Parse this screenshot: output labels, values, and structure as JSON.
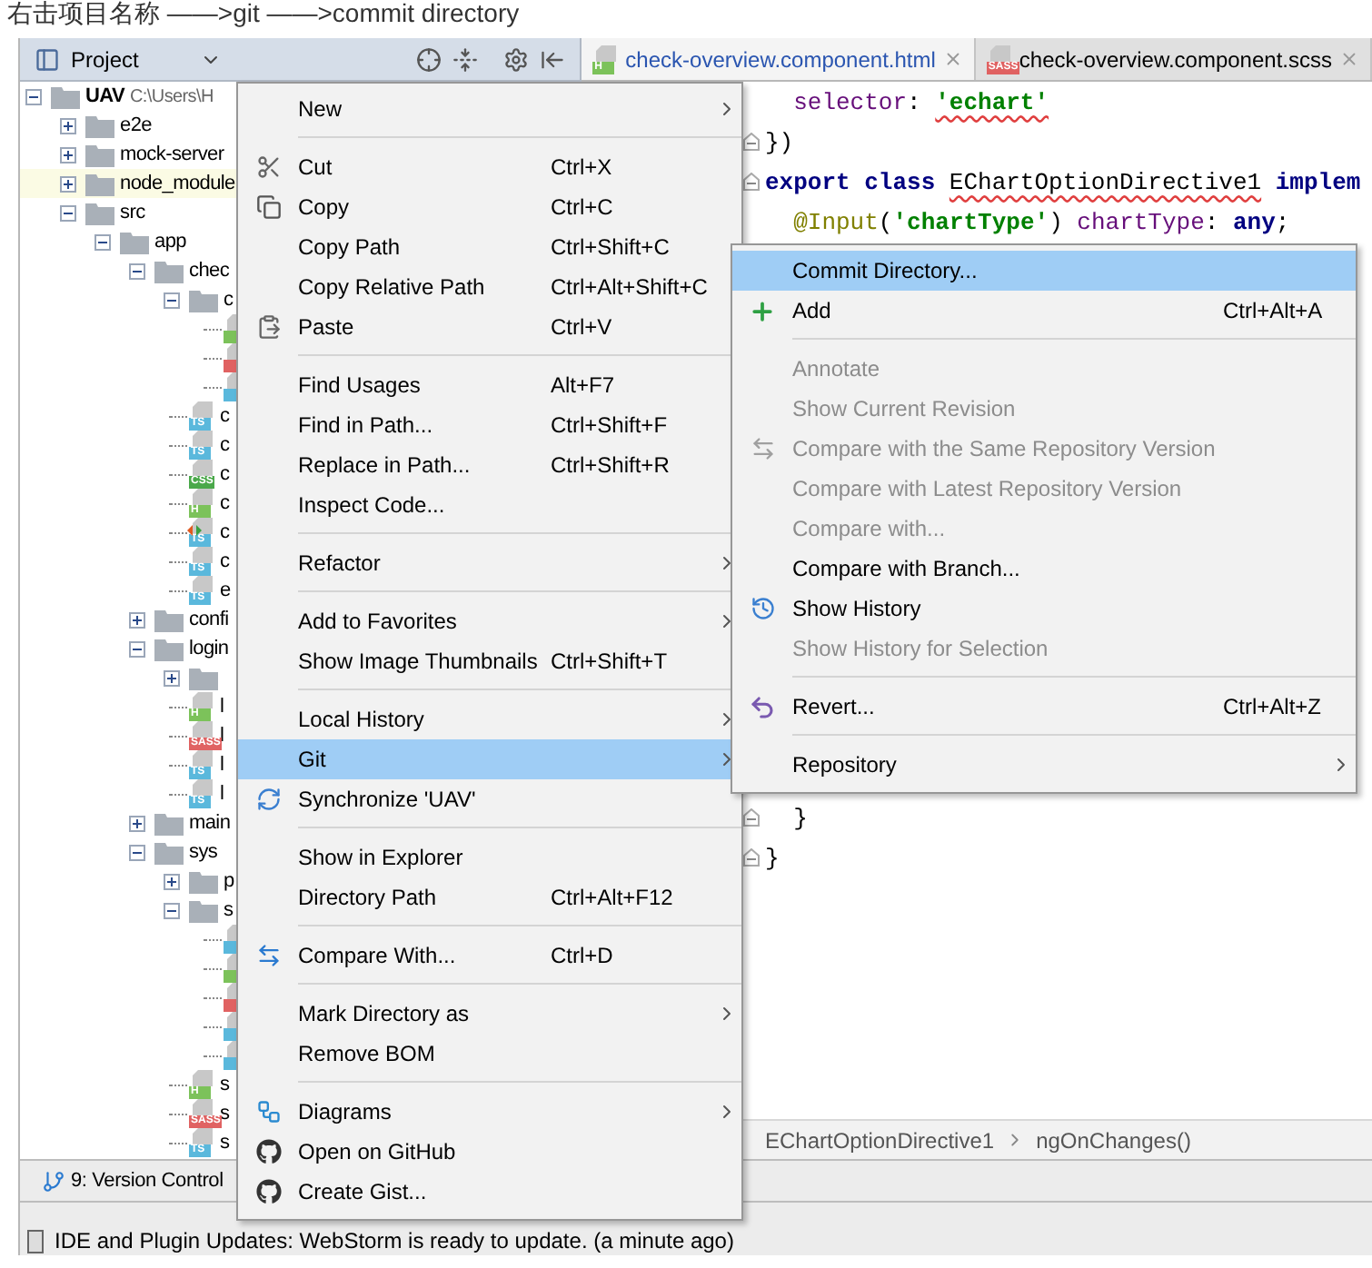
{
  "caption": "右击项目名称 ——>git ——>commit directory",
  "tool_window": {
    "title": "Project"
  },
  "editor_tabs": [
    {
      "label": "check-overview.component.html",
      "badge": "H",
      "color": "#7cc25a",
      "selected": true,
      "modified": true
    },
    {
      "label": "check-overview.component.scss",
      "badge": "SASS",
      "color": "#e06262",
      "selected": false,
      "modified": false
    }
  ],
  "project_tree": [
    {
      "name": "UAV",
      "path": "C:\\Users\\H",
      "kind": "folder",
      "expanded": true,
      "highlighted": false,
      "children": [
        {
          "name": "e2e",
          "kind": "folder",
          "expanded": false,
          "highlighted": false
        },
        {
          "name": "mock-server",
          "kind": "folder",
          "expanded": false,
          "highlighted": false
        },
        {
          "name": "node_module",
          "kind": "folder",
          "expanded": false,
          "highlighted": true
        },
        {
          "name": "src",
          "kind": "folder",
          "expanded": true,
          "highlighted": false,
          "children": [
            {
              "name": "app",
              "kind": "folder",
              "expanded": true,
              "highlighted": false,
              "children": [
                {
                  "name": "chec",
                  "kind": "folder",
                  "expanded": true,
                  "highlighted": false,
                  "children": [
                    {
                      "name": "c",
                      "kind": "folder",
                      "expanded": true,
                      "highlighted": false,
                      "children": [
                        {
                          "color": "#7cc25a",
                          "changed": false
                        },
                        {
                          "color": "#e06262",
                          "changed": false
                        },
                        {
                          "color": "#5ab8dc",
                          "changed": false
                        }
                      ]
                    },
                    {
                      "name": "c",
                      "kind": "file",
                      "color": "#5ab8dc",
                      "badge": "TS",
                      "changed": false
                    },
                    {
                      "name": "c",
                      "kind": "file",
                      "color": "#5ab8dc",
                      "badge": "TS",
                      "changed": false
                    },
                    {
                      "name": "c",
                      "kind": "file",
                      "color": "#4aa84a",
                      "badge": "CSS",
                      "changed": false
                    },
                    {
                      "name": "c",
                      "kind": "file",
                      "color": "#7cc25a",
                      "badge": "H",
                      "changed": false
                    },
                    {
                      "name": "c",
                      "kind": "file",
                      "color": "#5ab8dc",
                      "badge": "TS",
                      "changed": true
                    },
                    {
                      "name": "c",
                      "kind": "file",
                      "color": "#5ab8dc",
                      "badge": "TS",
                      "changed": false
                    },
                    {
                      "name": "e",
                      "kind": "file",
                      "color": "#5ab8dc",
                      "badge": "TS",
                      "changed": false
                    }
                  ]
                },
                {
                  "name": "confi",
                  "kind": "folder",
                  "expanded": false,
                  "highlighted": false
                },
                {
                  "name": "login",
                  "kind": "folder",
                  "expanded": true,
                  "highlighted": false,
                  "children": [
                    {
                      "kind": "folder",
                      "expanded": false,
                      "highlighted": false
                    },
                    {
                      "name": "l",
                      "kind": "file",
                      "color": "#7cc25a",
                      "badge": "H",
                      "changed": false
                    },
                    {
                      "name": "l",
                      "kind": "file",
                      "color": "#e06262",
                      "badge": "SASS",
                      "changed": false
                    },
                    {
                      "name": "l",
                      "kind": "file",
                      "color": "#5ab8dc",
                      "badge": "TS",
                      "changed": false
                    },
                    {
                      "name": "l",
                      "kind": "file",
                      "color": "#5ab8dc",
                      "badge": "TS",
                      "changed": false
                    }
                  ]
                },
                {
                  "name": "main",
                  "kind": "folder",
                  "expanded": false,
                  "highlighted": false
                },
                {
                  "name": "sys",
                  "kind": "folder",
                  "expanded": true,
                  "highlighted": false,
                  "children": [
                    {
                      "name": "p",
                      "kind": "folder",
                      "expanded": false,
                      "highlighted": false
                    },
                    {
                      "name": "s",
                      "kind": "folder",
                      "expanded": true,
                      "highlighted": false,
                      "children": [
                        {
                          "color": "#5ab8dc",
                          "changed": false
                        },
                        {
                          "color": "#7cc25a",
                          "changed": false
                        },
                        {
                          "color": "#e06262",
                          "changed": false
                        },
                        {
                          "color": "#5ab8dc",
                          "changed": false
                        },
                        {
                          "color": "#5ab8dc",
                          "changed": false
                        }
                      ]
                    },
                    {
                      "name": "s",
                      "kind": "file",
                      "color": "#7cc25a",
                      "badge": "H",
                      "changed": false
                    },
                    {
                      "name": "s",
                      "kind": "file",
                      "color": "#e06262",
                      "badge": "SASS",
                      "changed": false
                    },
                    {
                      "name": "s",
                      "kind": "file",
                      "color": "#5ab8dc",
                      "badge": "TS",
                      "changed": false
                    }
                  ]
                }
              ]
            }
          ]
        }
      ]
    }
  ],
  "editor": {
    "code_top": [
      {
        "fold": false,
        "tokens": [
          {
            "text": "  selector",
            "kind": "field"
          },
          {
            "text": ": ",
            "kind": "plain"
          },
          {
            "text": "'echart'",
            "kind": "string",
            "squiggle": true
          }
        ]
      },
      {
        "fold": true,
        "tokens": [
          {
            "text": "})",
            "kind": "plain"
          }
        ]
      },
      {
        "fold": true,
        "tokens": [
          {
            "text": "export class ",
            "kind": "keyword"
          },
          {
            "text": "EChartOptionDirective1",
            "kind": "plain",
            "squiggle": true
          },
          {
            "text": " implem",
            "kind": "keyword"
          }
        ]
      },
      {
        "fold": false,
        "tokens": [
          {
            "text": "  @Input",
            "kind": "annotation"
          },
          {
            "text": "(",
            "kind": "plain"
          },
          {
            "text": "'chartType'",
            "kind": "string"
          },
          {
            "text": ") ",
            "kind": "plain"
          },
          {
            "text": "chartType",
            "kind": "field"
          },
          {
            "text": ": ",
            "kind": "plain"
          },
          {
            "text": "any",
            "kind": "keyword"
          },
          {
            "text": ";",
            "kind": "plain"
          }
        ]
      }
    ],
    "code_bottom": [
      {
        "fold": true,
        "tokens": [
          {
            "text": "  }"
          }
        ]
      },
      {
        "fold": true,
        "tokens": [
          {
            "text": "}"
          }
        ]
      }
    ],
    "breadcrumbs": [
      "EChartOptionDirective1",
      "ngOnChanges()"
    ]
  },
  "tool_strip": {
    "label": "9: Version Control"
  },
  "status_bar": "IDE and Plugin Updates: WebStorm is ready to update. (a minute ago)",
  "context_menu": [
    {
      "kind": "item",
      "label": "New",
      "submenu": true,
      "selected": false
    },
    {
      "kind": "separator"
    },
    {
      "kind": "cut",
      "label": "Cut",
      "shortcut": "Ctrl+X",
      "selected": false
    },
    {
      "kind": "copy",
      "label": "Copy",
      "shortcut": "Ctrl+C",
      "selected": false
    },
    {
      "kind": "item",
      "label": "Copy Path",
      "shortcut": "Ctrl+Shift+C",
      "selected": false
    },
    {
      "kind": "item",
      "label": "Copy Relative Path",
      "shortcut": "Ctrl+Alt+Shift+C",
      "selected": false
    },
    {
      "kind": "paste",
      "label": "Paste",
      "shortcut": "Ctrl+V",
      "selected": false
    },
    {
      "kind": "separator"
    },
    {
      "kind": "item",
      "label": "Find Usages",
      "shortcut": "Alt+F7",
      "selected": false
    },
    {
      "kind": "item",
      "label": "Find in Path...",
      "shortcut": "Ctrl+Shift+F",
      "selected": false
    },
    {
      "kind": "item",
      "label": "Replace in Path...",
      "shortcut": "Ctrl+Shift+R",
      "selected": false
    },
    {
      "kind": "item",
      "label": "Inspect Code...",
      "selected": false
    },
    {
      "kind": "separator"
    },
    {
      "kind": "item",
      "label": "Refactor",
      "submenu": true,
      "selected": false
    },
    {
      "kind": "separator"
    },
    {
      "kind": "item",
      "label": "Add to Favorites",
      "submenu": true,
      "selected": false
    },
    {
      "kind": "item",
      "label": "Show Image Thumbnails",
      "shortcut": "Ctrl+Shift+T",
      "selected": false
    },
    {
      "kind": "separator"
    },
    {
      "kind": "item",
      "label": "Local History",
      "submenu": true,
      "selected": false
    },
    {
      "kind": "item",
      "label": "Git",
      "submenu": true,
      "selected": true
    },
    {
      "kind": "sync",
      "label": "Synchronize 'UAV'",
      "selected": false
    },
    {
      "kind": "separator"
    },
    {
      "kind": "item",
      "label": "Show in Explorer",
      "selected": false
    },
    {
      "kind": "item",
      "label": "Directory Path",
      "shortcut": "Ctrl+Alt+F12",
      "selected": false
    },
    {
      "kind": "separator"
    },
    {
      "kind": "compare",
      "label": "Compare With...",
      "shortcut": "Ctrl+D",
      "selected": false
    },
    {
      "kind": "separator"
    },
    {
      "kind": "item",
      "label": "Mark Directory as",
      "submenu": true,
      "selected": false
    },
    {
      "kind": "item",
      "label": "Remove BOM",
      "selected": false
    },
    {
      "kind": "separator"
    },
    {
      "kind": "diagrams",
      "label": "Diagrams",
      "submenu": true,
      "selected": false
    },
    {
      "kind": "github",
      "label": "Open on GitHub",
      "selected": false
    },
    {
      "kind": "github",
      "label": "Create Gist...",
      "selected": false
    }
  ],
  "git_submenu": [
    {
      "kind": "item",
      "label": "Commit Directory...",
      "selected": true,
      "disabled": false
    },
    {
      "kind": "add",
      "label": "Add",
      "shortcut": "Ctrl+Alt+A",
      "selected": false,
      "disabled": false
    },
    {
      "kind": "separator"
    },
    {
      "kind": "item",
      "label": "Annotate",
      "selected": false,
      "disabled": true
    },
    {
      "kind": "item",
      "label": "Show Current Revision",
      "selected": false,
      "disabled": true
    },
    {
      "kind": "compare",
      "label": "Compare with the Same Repository Version",
      "selected": false,
      "disabled": true
    },
    {
      "kind": "item",
      "label": "Compare with Latest Repository Version",
      "selected": false,
      "disabled": true
    },
    {
      "kind": "item",
      "label": "Compare with...",
      "selected": false,
      "disabled": true
    },
    {
      "kind": "item",
      "label": "Compare with Branch...",
      "selected": false,
      "disabled": false
    },
    {
      "kind": "history",
      "label": "Show History",
      "selected": false,
      "disabled": false
    },
    {
      "kind": "item",
      "label": "Show History for Selection",
      "selected": false,
      "disabled": true
    },
    {
      "kind": "separator"
    },
    {
      "kind": "revert",
      "label": "Revert...",
      "shortcut": "Ctrl+Alt+Z",
      "selected": false,
      "disabled": false
    },
    {
      "kind": "separator"
    },
    {
      "kind": "item",
      "label": "Repository",
      "submenu": true,
      "selected": false,
      "disabled": false
    }
  ]
}
